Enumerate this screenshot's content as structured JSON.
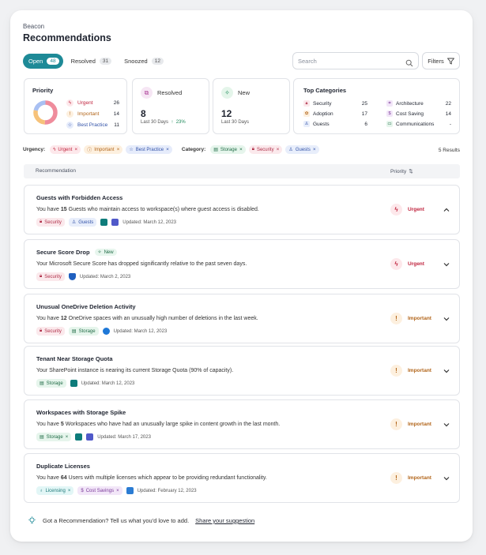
{
  "app": {
    "name": "Beacon",
    "title": "Recommendations"
  },
  "tabs": [
    {
      "label": "Open",
      "count": "48"
    },
    {
      "label": "Resolved",
      "count": "31"
    },
    {
      "label": "Snoozed",
      "count": "12"
    }
  ],
  "search": {
    "placeholder": "Search"
  },
  "filters_label": "Filters",
  "priority_box": {
    "title": "Priority",
    "items": [
      {
        "label": "Urgent",
        "count": "26"
      },
      {
        "label": "Important",
        "count": "14"
      },
      {
        "label": "Best Practice",
        "count": "11"
      }
    ],
    "donut": [
      26,
      14,
      11
    ]
  },
  "resolved_box": {
    "label": "Resolved",
    "value": "8",
    "sub": "Last 30 Days",
    "delta": "23%"
  },
  "new_box": {
    "label": "New",
    "value": "12",
    "sub": "Last 30 Days"
  },
  "categories_box": {
    "title": "Top Categories",
    "items": [
      {
        "label": "Security",
        "count": "25"
      },
      {
        "label": "Adoption",
        "count": "17"
      },
      {
        "label": "Guests",
        "count": "6"
      },
      {
        "label": "Architecture",
        "count": "22"
      },
      {
        "label": "Cost Saving",
        "count": "14"
      },
      {
        "label": "Communications",
        "count": "-"
      }
    ]
  },
  "filter_row": {
    "urgency_label": "Urgency:",
    "urgency": [
      "Urgent",
      "Important",
      "Best Practice"
    ],
    "category_label": "Category:",
    "category": [
      "Storage",
      "Security",
      "Guests"
    ],
    "results": "5 Results"
  },
  "table": {
    "col1": "Recommendation",
    "col2": "Priority"
  },
  "recs": [
    {
      "title": "Guests with Forbidden Access",
      "desc_pre": "You have ",
      "desc_num": "15",
      "desc_post": " Guests who maintain access to workspace(s) where guest access is disabled.",
      "tags": [
        "Security",
        "Guests"
      ],
      "updated": "Updated: March 12, 2023",
      "priority": "Urgent"
    },
    {
      "title": "Secure Score Drop",
      "badge": "New",
      "desc": "Your Microsoft Secure Score has dropped significantly relative to the past seven days.",
      "tags": [
        "Security"
      ],
      "updated": "Updated: March 2, 2023",
      "priority": "Urgent"
    },
    {
      "title": "Unusual OneDrive Deletion Activity",
      "desc_pre": "You have ",
      "desc_num": "12",
      "desc_post": " OneDrive spaces with an unusually high number of deletions in the last week.",
      "tags": [
        "Security",
        "Storage"
      ],
      "updated": "Updated: March 12, 2023",
      "priority": "Important"
    },
    {
      "title": "Tenant Near Storage Quota",
      "desc": "Your SharePoint instance is nearing its current Storage Quota (90% of capacity).",
      "tags": [
        "Storage"
      ],
      "updated": "Updated: March 12, 2023",
      "priority": "Important"
    },
    {
      "title": "Workspaces with Storage Spike",
      "desc_pre": "You have ",
      "desc_num": "5",
      "desc_post": " Workspaces who have had an unusually large spike in content growth in the last month.",
      "tags": [
        "Storage"
      ],
      "updated": "Updated: March 17, 2023",
      "priority": "Important"
    },
    {
      "title": "Duplicate Licenses",
      "desc_pre": "You have ",
      "desc_num": "64",
      "desc_post": " Users with multiple licenses which appear to be providing redundant functionality.",
      "tags": [
        "Licensing",
        "Cost Savings"
      ],
      "updated": "Updated: February 12, 2023",
      "priority": "Important"
    }
  ],
  "footer": {
    "text": "Got a Recommendation? Tell us what you'd love to add.",
    "link": "Share your suggestion"
  },
  "colors": {
    "accent": "#1e8a97",
    "urgent": "#c0243e",
    "important": "#b2651a",
    "best_practice": "#3252a8"
  }
}
